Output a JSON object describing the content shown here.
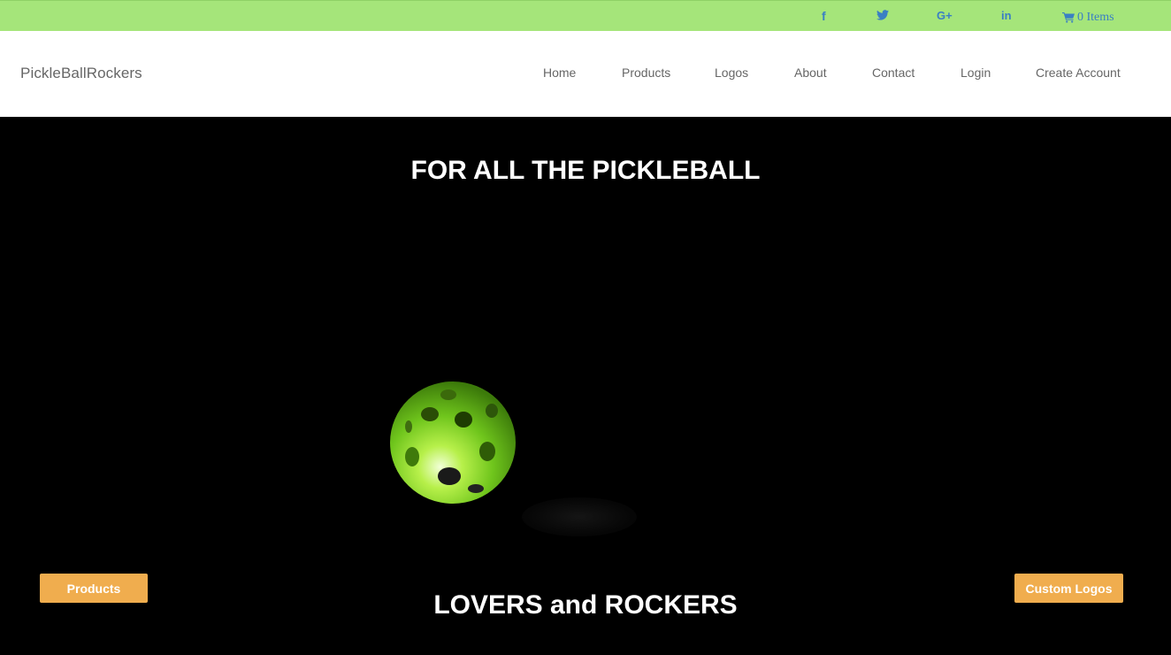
{
  "topbar": {
    "social": [
      {
        "name": "facebook-icon",
        "glyph": "f"
      },
      {
        "name": "twitter-icon",
        "glyph": "🐦"
      },
      {
        "name": "google-plus-icon",
        "glyph": "G+"
      },
      {
        "name": "linkedin-icon",
        "glyph": "in"
      }
    ],
    "cart_icon": "shopping-cart-icon",
    "cart_label": "0 Items",
    "colors": {
      "bar": "#a5e57a",
      "icons": "#3a7fc4"
    }
  },
  "header": {
    "brand": "PickleBallRockers",
    "nav": [
      "Home",
      "Products",
      "Logos",
      "About",
      "Contact",
      "Login",
      "Create Account"
    ]
  },
  "hero": {
    "title_top": "FOR ALL THE PICKLEBALL",
    "title_bottom": "LOVERS and ROCKERS",
    "image": "pickleball-image",
    "buttons": {
      "products": "Products",
      "custom_logos": "Custom Logos"
    },
    "colors": {
      "button": "#f0ad4e",
      "ball": "#7ccf1e"
    }
  }
}
